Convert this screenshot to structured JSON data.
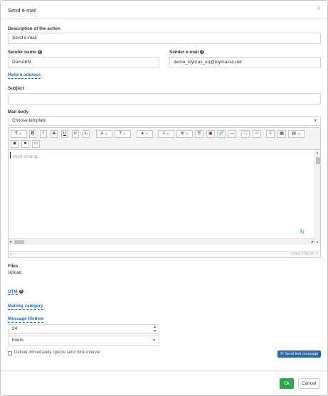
{
  "modal": {
    "title": "Send e-mail",
    "close": "×"
  },
  "description": {
    "label": "Description of the action",
    "value": "Send e-mail"
  },
  "sender_name": {
    "label": "Sender name",
    "value": "DemoEN"
  },
  "sender_email": {
    "label": "Sender e-mail",
    "value": "demo_loymax_en@loymaxsc.net"
  },
  "return_address_link": "Return address",
  "subject": {
    "label": "Subject",
    "value": ""
  },
  "mail_body": {
    "label": "Mail body",
    "template_placeholder": "Choose template"
  },
  "editor": {
    "toolbar_row1": [
      "¶ ⌄",
      "B",
      "I",
      "S",
      "U",
      "x²",
      "x₂",
      "A ⌄",
      "T ⌄",
      "● ⌄",
      "≡ ⌄",
      "≣ ⌄",
      "☰",
      "▣",
      "🔗",
      "—",
      "⛶",
      "‹›",
      "≡",
      "▦",
      "▤ ⌄"
    ],
    "toolbar_row2": [
      "◉",
      "■",
      "▭"
    ],
    "placeholder": "Start writing...",
    "status": "Chars: 0   Words: 0",
    "resize_glyph": "≡",
    "loader_glyph": "↻"
  },
  "files": {
    "label": "Files",
    "upload_link": "Upload"
  },
  "utm_link": "UTM",
  "mailing_category_link": "Mailing category",
  "message_lifetime": {
    "label": "Message lifetime",
    "value": "24",
    "unit": "hours"
  },
  "deliver_checkbox": {
    "label": "Deliver immediately, ignore send time interval",
    "checked": false
  },
  "send_test_button": "Send test message",
  "ok_button": "Ok",
  "cancel_button": "Cancel"
}
